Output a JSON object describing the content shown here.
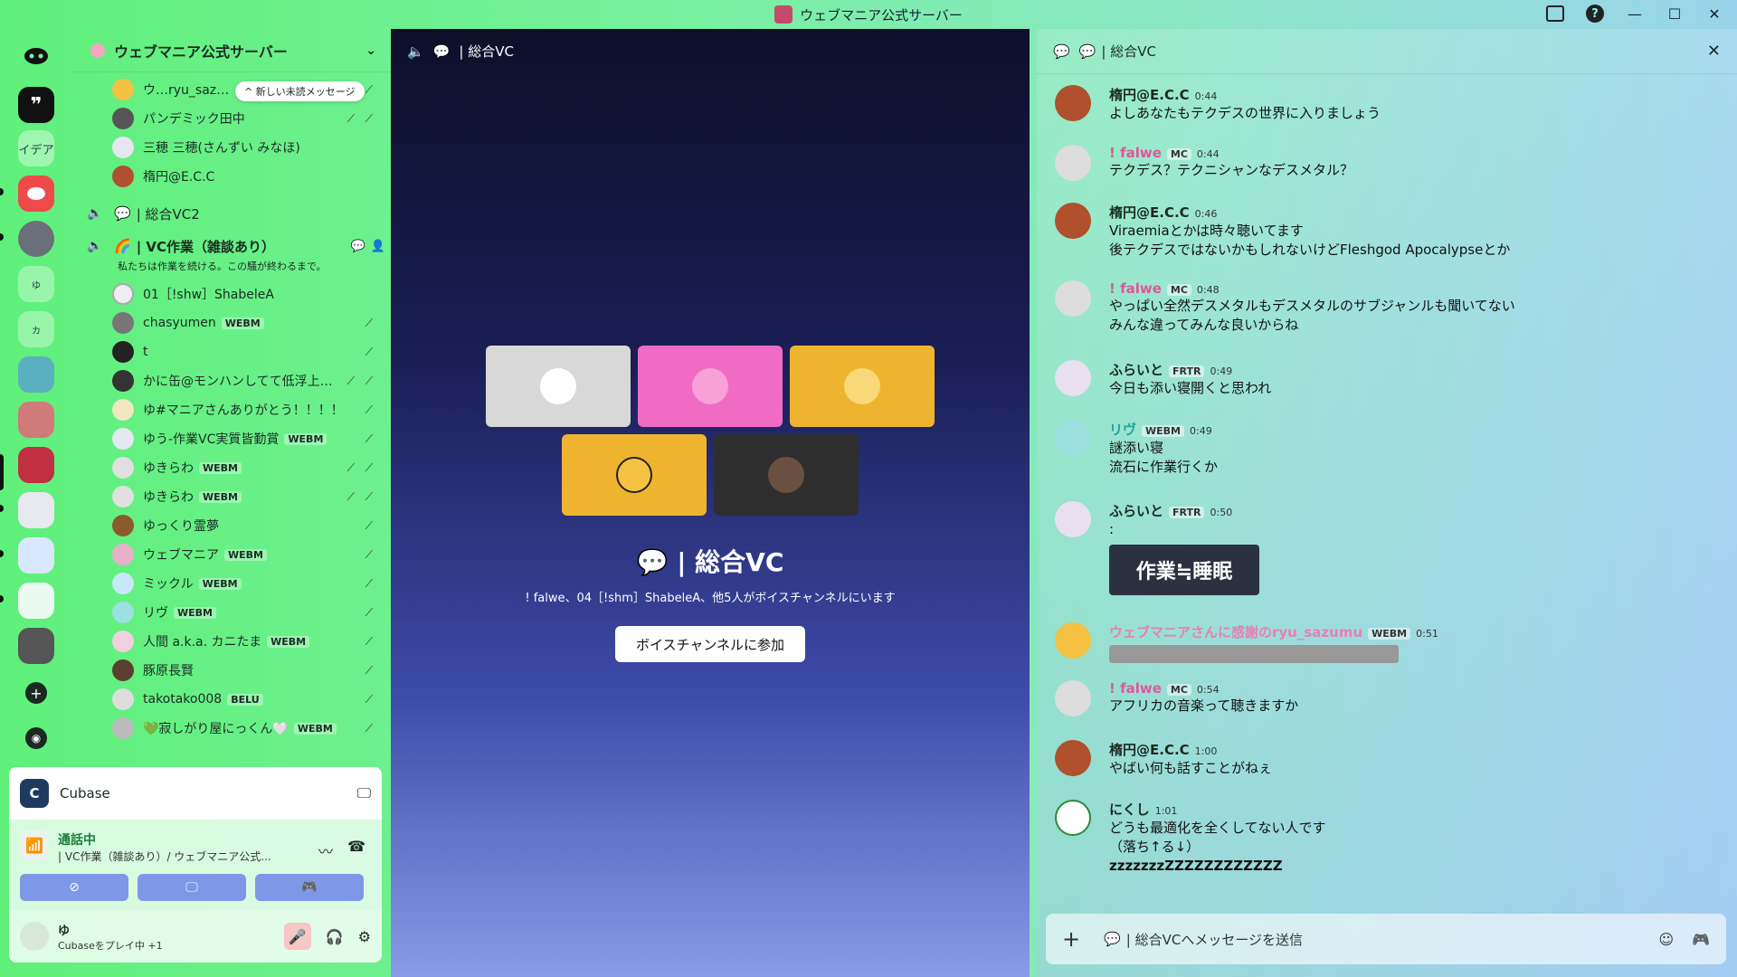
{
  "window": {
    "title": "ウェブマニア公式サーバー"
  },
  "sidebar": {
    "server_name": "ウェブマニア公式サーバー",
    "unread_pill": "^ 新しい未読メッセージ",
    "top_members": [
      {
        "name": "ウ…ryu_saz…"
      },
      {
        "name": "パンデミック田中"
      },
      {
        "name": "三穂 三穂(さんずい みなほ)"
      },
      {
        "name": "楕円@E.C.C"
      }
    ],
    "vc2": {
      "label": "| 総合VC2"
    },
    "vc_work": {
      "label": "| VC作業（雑談あり）",
      "desc": "私たちは作業を続ける。この騒が終わるまで。"
    },
    "members": [
      {
        "name": "01［!shw］ShabeleA",
        "tag": ""
      },
      {
        "name": "chasyumen",
        "tag": "WEBM"
      },
      {
        "name": "t",
        "tag": ""
      },
      {
        "name": "かに缶@モンハンしてて低浮上…",
        "tag": ""
      },
      {
        "name": "ゆ#マニアさんありがとう！！！！",
        "tag": ""
      },
      {
        "name": "ゆう-作業VC実質皆勤賞",
        "tag": "WEBM"
      },
      {
        "name": "ゆきらわ",
        "tag": "WEBM"
      },
      {
        "name": "ゆきらわ",
        "tag": "WEBM"
      },
      {
        "name": "ゆっくり霊夢",
        "tag": ""
      },
      {
        "name": "ウェブマニア",
        "tag": "WEBM"
      },
      {
        "name": "ミックル",
        "tag": "WEBM"
      },
      {
        "name": "リヴ",
        "tag": "WEBM"
      },
      {
        "name": "人間 a.k.a. カニたま",
        "tag": "WEBM"
      },
      {
        "name": "豚原長賢",
        "tag": ""
      },
      {
        "name": "takotako008",
        "tag": "BELU"
      },
      {
        "name": "💚寂しがり屋にっくん🤍",
        "tag": "WEBM"
      }
    ],
    "activity": {
      "app": "Cubase"
    },
    "voice": {
      "status": "通話中",
      "channel": "| VC作業（雑談あり）/ ウェブマニア公式..."
    },
    "user": {
      "name": "ゆ",
      "status": "Cubaseをプレイ中 +1"
    }
  },
  "stage": {
    "channel": "| 総合VC",
    "title": "| 総合VC",
    "subtitle": "! falwe、04［!shm］ShabeleA、他5人がボイスチャンネルにいます",
    "join_label": "ボイスチャンネルに参加",
    "tiles": [
      {
        "color": "#d8d8d8"
      },
      {
        "color": "#f06cc4"
      },
      {
        "color": "#efb42f"
      },
      {
        "color": "#efb42f"
      },
      {
        "color": "#2e2e2e"
      }
    ]
  },
  "chat": {
    "channel": "| 総合VC",
    "placeholder": "| 総合VCへメッセージを送信",
    "messages": [
      {
        "name": "楕円@E.C.C",
        "time": "0:44",
        "tag": "",
        "lines": [
          "よしあなたもテクデスの世界に入りましょう"
        ]
      },
      {
        "name": "! falwe",
        "time": "0:44",
        "tag": "MC",
        "lines": [
          "テクデス？テクニシャンなデスメタル？"
        ]
      },
      {
        "name": "楕円@E.C.C",
        "time": "0:46",
        "tag": "",
        "lines": [
          "Viraemiaとかは時々聴いてます",
          "後テクデスではないかもしれないけどFleshgod Apocalypseとか"
        ]
      },
      {
        "name": "! falwe",
        "time": "0:48",
        "tag": "MC",
        "lines": [
          "やっぱい全然デスメタルもデスメタルのサブジャンルも聞いてない",
          "みんな違ってみんな良いからね"
        ]
      },
      {
        "name": "ふらいと",
        "time": "0:49",
        "tag": "FRTR",
        "lines": [
          "今日も添い寝開くと思われ"
        ]
      },
      {
        "name": "リヴ",
        "time": "0:49",
        "tag": "WEBM",
        "lines": [
          "謎添い寝",
          "流石に作業行くか"
        ]
      },
      {
        "name": "ふらいと",
        "time": "0:50",
        "tag": "FRTR",
        "lines": [
          ":"
        ],
        "image": "作業≒睡眠"
      },
      {
        "name": "ウェブマニアさんに感謝のryu_sazumu",
        "time": "0:51",
        "tag": "WEBM",
        "lines": []
      },
      {
        "name": "! falwe",
        "time": "0:54",
        "tag": "MC",
        "lines": [
          "アフリカの音楽って聴きますか"
        ]
      },
      {
        "name": "楕円@E.C.C",
        "time": "1:00",
        "tag": "",
        "lines": [
          "やばい何も話すことがねぇ"
        ]
      },
      {
        "name": "にくし",
        "time": "1:01",
        "tag": "",
        "lines": [
          "どうも最適化を全くしてない人です",
          "（落ち↑る↓）",
          "zzzzzzzZZZZZZZZZZZZ"
        ]
      }
    ]
  },
  "colors": {
    "accent": "#5865f2",
    "mute_red": "#d33333",
    "green": "#1a7d3a"
  }
}
